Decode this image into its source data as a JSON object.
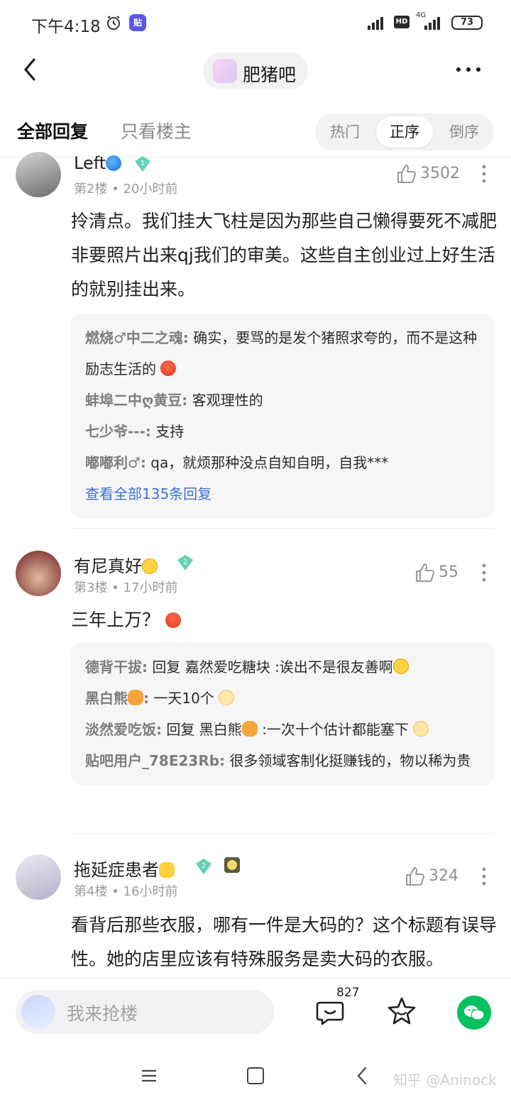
{
  "status_bar": {
    "time": "下午4:18",
    "hd": "HD",
    "network": "4G",
    "battery": "73"
  },
  "header": {
    "forum_name": "肥猪吧"
  },
  "tabs": {
    "all_replies": "全部回复",
    "op_only": "只看楼主",
    "sort": [
      "热门",
      "正序",
      "倒序"
    ],
    "sort_selected": "正序"
  },
  "posts": [
    {
      "username": "Left",
      "level": "1",
      "floor": "第2楼",
      "time": "20小时前",
      "likes": "3502",
      "body": "拎清点。我们挂大飞柱是因为那些自己懒得要死不减肥非要照片出来qj我们的审美。这些自主创业过上好生活的就别挂出来。",
      "replies": [
        {
          "name": "燃烧♂中二之魂:",
          "text": " 确实，要骂的是发个猪照求夸的，而不是这种励志生活的"
        },
        {
          "name": "蚌埠二中ღ黄豆:",
          "text": " 客观理性的"
        },
        {
          "name": "七少爷---:",
          "text": " 支持"
        },
        {
          "name": "嘟嘟利♂:",
          "text": " qa，就烦那种没点自知自明，自我***"
        }
      ],
      "more": "查看全部135条回复"
    },
    {
      "username": "有尼真好",
      "level": "2",
      "floor": "第3楼",
      "time": "17小时前",
      "likes": "55",
      "body": "三年上万？",
      "replies": [
        {
          "name": "德背干拔:",
          "text": " 回复  嘉然爱吃糖块 :诶出不是很友善啊"
        },
        {
          "name": "黑白熊",
          "name2": ":",
          "text": " 一天10个"
        },
        {
          "name": "淡然爱吃饭:",
          "text": " 回复  黑白熊",
          "text2": " :一次十个估计都能塞下"
        },
        {
          "name": "贴吧用户_78E23Rb:",
          "text": " 很多领域客制化挺赚钱的，物以稀为贵"
        }
      ]
    },
    {
      "username": "拖延症患者",
      "level": "2",
      "floor": "第4楼",
      "time": "16小时前",
      "likes": "324",
      "body": "看背后那些衣服，哪有一件是大码的？这个标题有误导性。她的店里应该有特殊服务是卖大码的衣服。"
    }
  ],
  "meta_separator": "•",
  "bottom_bar": {
    "placeholder": "我来抢楼",
    "comment_count": "827"
  },
  "watermark": "知乎 @Aninock",
  "colors": {
    "link": "#3b6fd6",
    "wechat": "#07c160",
    "level_badge": "#5fd3b3"
  }
}
